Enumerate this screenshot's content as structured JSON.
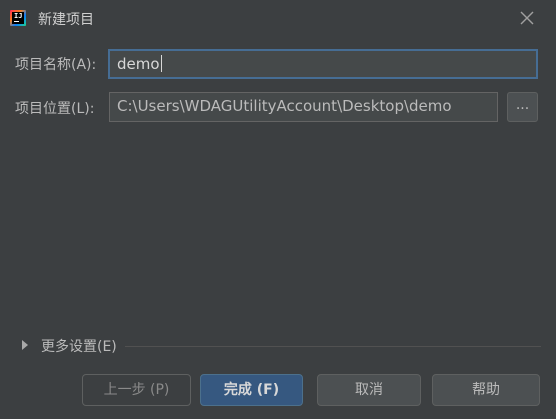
{
  "window": {
    "title": "新建项目",
    "close_icon": "close-icon",
    "app_icon": "intellij-idea-icon",
    "app_icon_text": "IJ"
  },
  "form": {
    "name_label": "项目名称(A):",
    "name_value": "demo",
    "location_label": "项目位置(L):",
    "location_value": "C:\\Users\\WDAGUtilityAccount\\Desktop\\demo",
    "browse_label": "..."
  },
  "more_settings": {
    "label": "更多设置(E)",
    "expanded": false
  },
  "buttons": {
    "previous": "上一步 (P)",
    "finish": "完成 (F)",
    "cancel": "取消",
    "help": "帮助"
  },
  "colors": {
    "background": "#3c3f41",
    "focus_border": "#466d94",
    "primary_button": "#365880"
  }
}
